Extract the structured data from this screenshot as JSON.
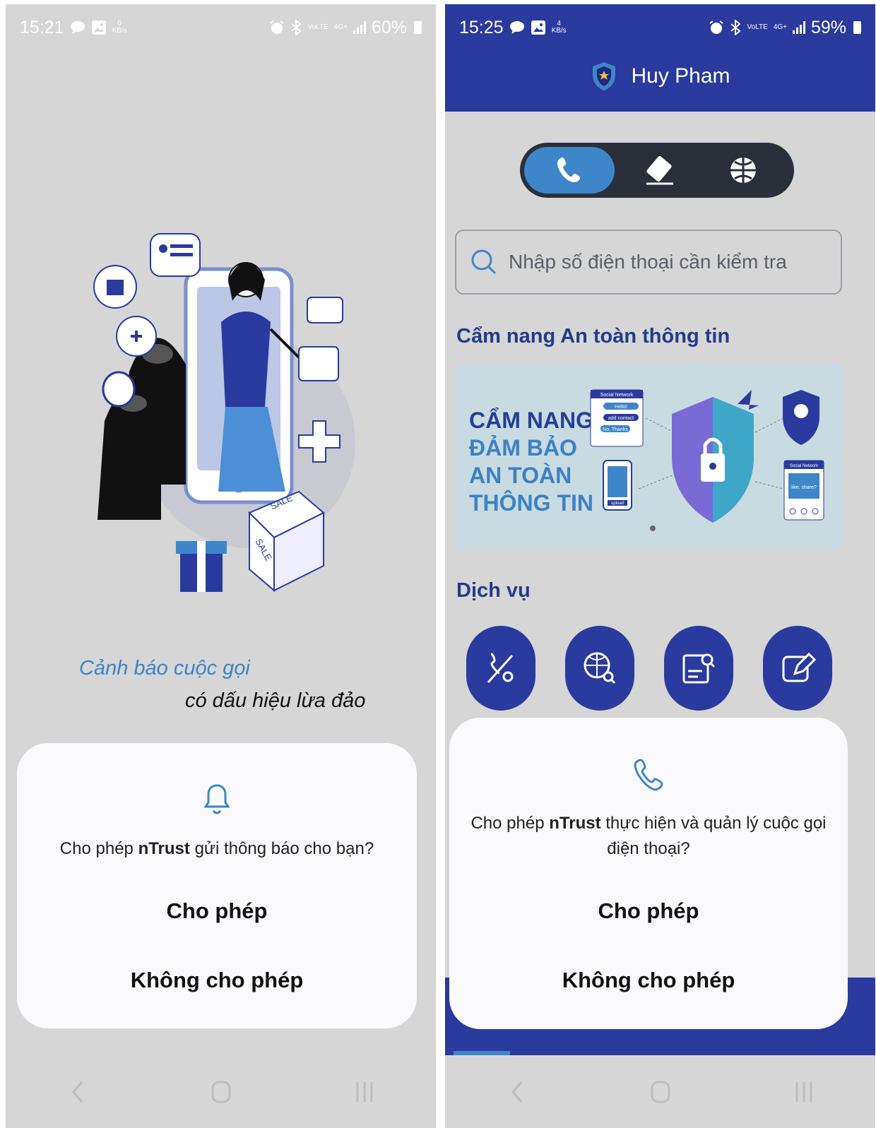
{
  "left": {
    "status": {
      "time": "15:21",
      "kbs_value": "0",
      "kbs_unit": "KB/s",
      "battery": "60%",
      "network_volte": "VoLTE",
      "network_type": "4G+"
    },
    "tagline_line1": "Cảnh báo cuộc gọi",
    "tagline_line2": "có dấu hiệu lừa đảo",
    "dialog": {
      "message_prefix": "Cho phép ",
      "app_name": "nTrust",
      "message_suffix": " gửi thông báo cho bạn?",
      "allow": "Cho phép",
      "deny": "Không cho phép",
      "icon": "bell-icon"
    },
    "illustration": {
      "sale_label_1": "SALE",
      "sale_label_2": "SALE"
    }
  },
  "right": {
    "status": {
      "time": "15:25",
      "kbs_value": "4",
      "kbs_unit": "KB/s",
      "battery": "59%",
      "network_volte": "VoLTE",
      "network_type": "4G+"
    },
    "header_title": "Huy Pham",
    "tabs": [
      {
        "icon": "phone-icon",
        "active": true
      },
      {
        "icon": "card-sign-icon",
        "active": false
      },
      {
        "icon": "globe-icon",
        "active": false
      }
    ],
    "search_placeholder": "Nhập số điện thoại cần kiểm tra",
    "handbook_title": "Cẩm nang An toàn thông tin",
    "banner": {
      "line1": "CẨM NANG",
      "line2": "ĐẢM BẢO",
      "line3": "AN TOÀN",
      "line4": "THÔNG TIN",
      "card1_title": "Social Network",
      "card1_chip1": "Hello!",
      "card1_chip2": "add contact",
      "card1_chip3": "No, Thanks",
      "card2_title": "Social Network",
      "card2_chip": "like, share?",
      "phone_chip": "upload"
    },
    "services_title": "Dịch vụ",
    "services": [
      "phone-check-icon",
      "web-search-icon",
      "document-search-icon",
      "edit-icon"
    ],
    "dialog": {
      "message_prefix": "Cho phép ",
      "app_name": "nTrust",
      "message_suffix": " thực hiện và quản lý cuộc gọi điện thoại?",
      "allow": "Cho phép",
      "deny": "Không cho phép",
      "icon": "phone-icon"
    }
  },
  "colors": {
    "primary": "#2a3a9e",
    "accent": "#3e86c8",
    "scrim": "#d6d6d6"
  }
}
